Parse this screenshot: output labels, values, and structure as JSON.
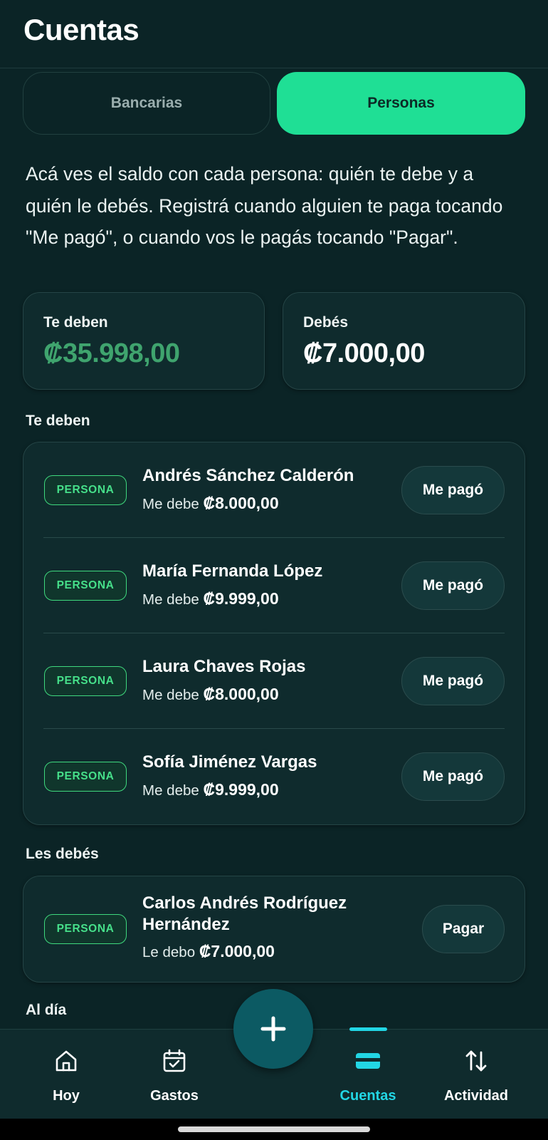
{
  "header": {
    "title": "Cuentas"
  },
  "tabs": [
    {
      "label": "Bancarias",
      "selected": false
    },
    {
      "label": "Personas",
      "selected": true
    }
  ],
  "intro_text": "Acá ves el saldo con cada persona: quién te debe y a quién le debés. Registrá cuando alguien te paga tocando \"Me pagó\", o cuando vos le pagás tocando \"Pagar\".",
  "summary": {
    "owed_to_me_label": "Te deben",
    "owed_to_me_amount": "₡35.998,00",
    "i_owe_label": "Debés",
    "i_owe_amount": "₡7.000,00"
  },
  "owed_to_me": {
    "title": "Te deben",
    "items": [
      {
        "badge": "PERSONA",
        "name": "Andrés Sánchez Calderón",
        "prefix": "Me debe",
        "amount": "₡8.000,00",
        "action": "Me pagó"
      },
      {
        "badge": "PERSONA",
        "name": "María Fernanda López",
        "prefix": "Me debe",
        "amount": "₡9.999,00",
        "action": "Me pagó"
      },
      {
        "badge": "PERSONA",
        "name": "Laura Chaves Rojas",
        "prefix": "Me debe",
        "amount": "₡8.000,00",
        "action": "Me pagó"
      },
      {
        "badge": "PERSONA",
        "name": "Sofía Jiménez Vargas",
        "prefix": "Me debe",
        "amount": "₡9.999,00",
        "action": "Me pagó"
      }
    ]
  },
  "i_owe": {
    "title": "Les debés",
    "items": [
      {
        "badge": "PERSONA",
        "name_line1": "Carlos Andrés Rodríguez",
        "name_line2": "Hernández",
        "prefix": "Le debo",
        "amount": "₡7.000,00",
        "action": "Pagar"
      }
    ]
  },
  "settled": {
    "title": "Al día"
  },
  "nav": {
    "items": [
      {
        "label": "Hoy",
        "icon": "home-icon"
      },
      {
        "label": "Gastos",
        "icon": "calendar-check-icon"
      },
      {
        "label": "Cuentas",
        "icon": "card-icon",
        "active": true
      },
      {
        "label": "Actividad",
        "icon": "swap-vertical-icon"
      }
    ],
    "fab_icon": "plus-icon"
  },
  "colors": {
    "background": "#0b2426",
    "accent": "#1fdf95",
    "badge_green": "#46e08a",
    "positive_amount": "#3fa46e",
    "active_nav": "#22d6e4",
    "fab": "#0c5a63"
  }
}
